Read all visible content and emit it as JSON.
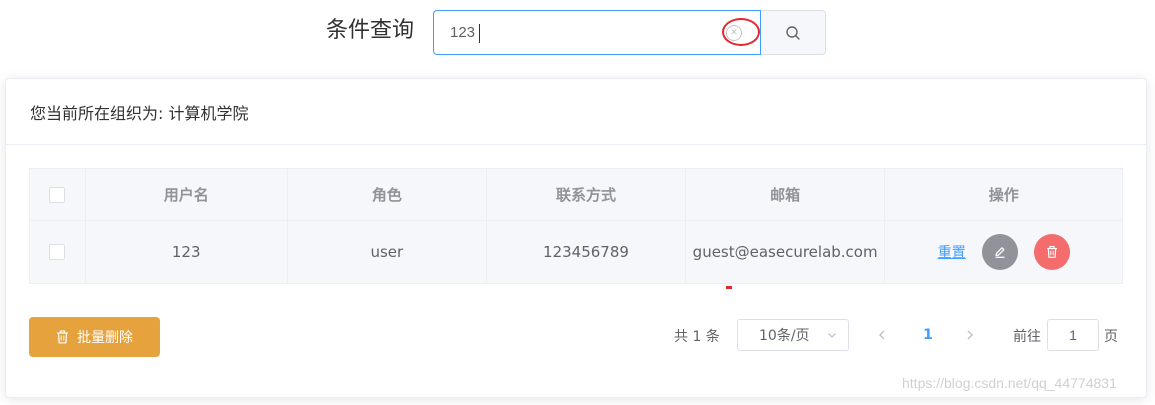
{
  "search": {
    "label": "条件查询",
    "value": "123",
    "clear_icon": "circle-x-icon",
    "search_icon": "search-icon"
  },
  "card": {
    "header": "您当前所在组织为: 计算机学院"
  },
  "table": {
    "columns": [
      "用户名",
      "角色",
      "联系方式",
      "邮箱",
      "操作"
    ],
    "rows": [
      {
        "username": "123",
        "role": "user",
        "phone": "123456789",
        "email": "guest@easecurelab.com",
        "reset_label": "重置"
      }
    ]
  },
  "footer": {
    "batch_delete_label": "批量删除",
    "total": "共 1 条",
    "page_size": "10条/页",
    "current_page": "1",
    "goto_prefix": "前往",
    "goto_value": "1",
    "goto_suffix": "页"
  },
  "watermark": "https://blog.csdn.net/qq_44774831",
  "colors": {
    "primary": "#409eff",
    "warning": "#e6a23c",
    "danger": "#f56c6c",
    "info": "#909399",
    "highlight": "#e5262c"
  }
}
